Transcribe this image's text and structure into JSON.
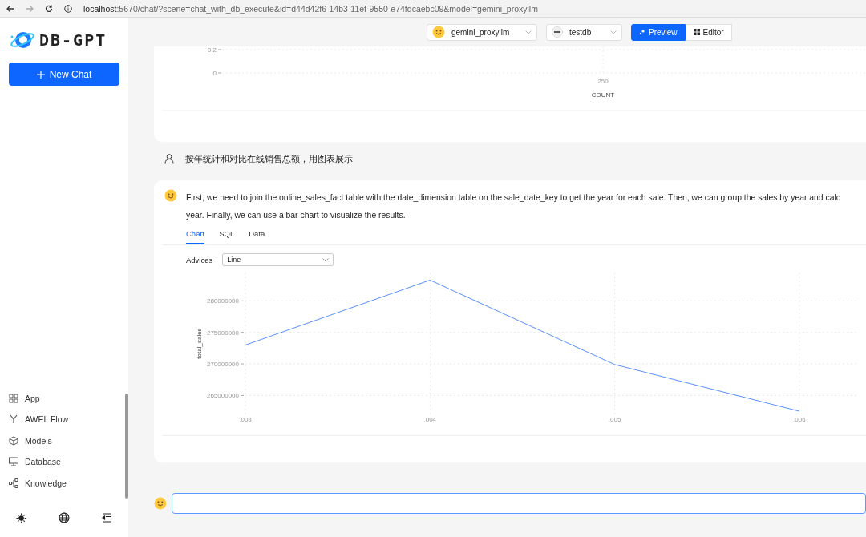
{
  "browser": {
    "url_host": "localhost",
    "url_rest": ":5670/chat/?scene=chat_with_db_execute&id=d44d42f6-14b3-11ef-9550-e74fdcaebc09&model=gemini_proxyllm"
  },
  "sidebar": {
    "logo": "DB-GPT",
    "new_chat": "New Chat",
    "items": [
      {
        "label": "App"
      },
      {
        "label": "AWEL Flow"
      },
      {
        "label": "Models"
      },
      {
        "label": "Database"
      },
      {
        "label": "Knowledge"
      }
    ]
  },
  "toolbar": {
    "model": "gemini_proxyllm",
    "database": "testdb",
    "modes": [
      {
        "label": "Preview",
        "selected": true
      },
      {
        "label": "Editor",
        "selected": false
      }
    ]
  },
  "previous_chart": {
    "y_ticks": [
      "0.2",
      "0"
    ],
    "x_tick": "250",
    "x_label": "COUNT"
  },
  "question": "按年统计和对比在线销售总额，用图表展示",
  "answer": {
    "lines": [
      "First, we need to join the online_sales_fact table with the date_dimension table on the sale_date_key to get the year for each sale. Then, we can group the sales by year and calc",
      "year. Finally, we can use a bar chart to visualize the results."
    ],
    "tabs": [
      {
        "label": "Chart",
        "selected": true
      },
      {
        "label": "SQL",
        "selected": false
      },
      {
        "label": "Data",
        "selected": false
      }
    ],
    "advices_label": "Advices",
    "advices_value": "Line",
    "chart_data": {
      "type": "line",
      "ylabel": "total_sales",
      "categories": [
        ".003",
        ".004",
        ".005",
        ".006"
      ],
      "values": [
        273000000,
        283300000,
        269900000,
        262500000
      ],
      "grid": true,
      "ylim": [
        262000000,
        284500000
      ],
      "yticks": [
        265000000,
        270000000,
        275000000,
        280000000
      ]
    }
  }
}
